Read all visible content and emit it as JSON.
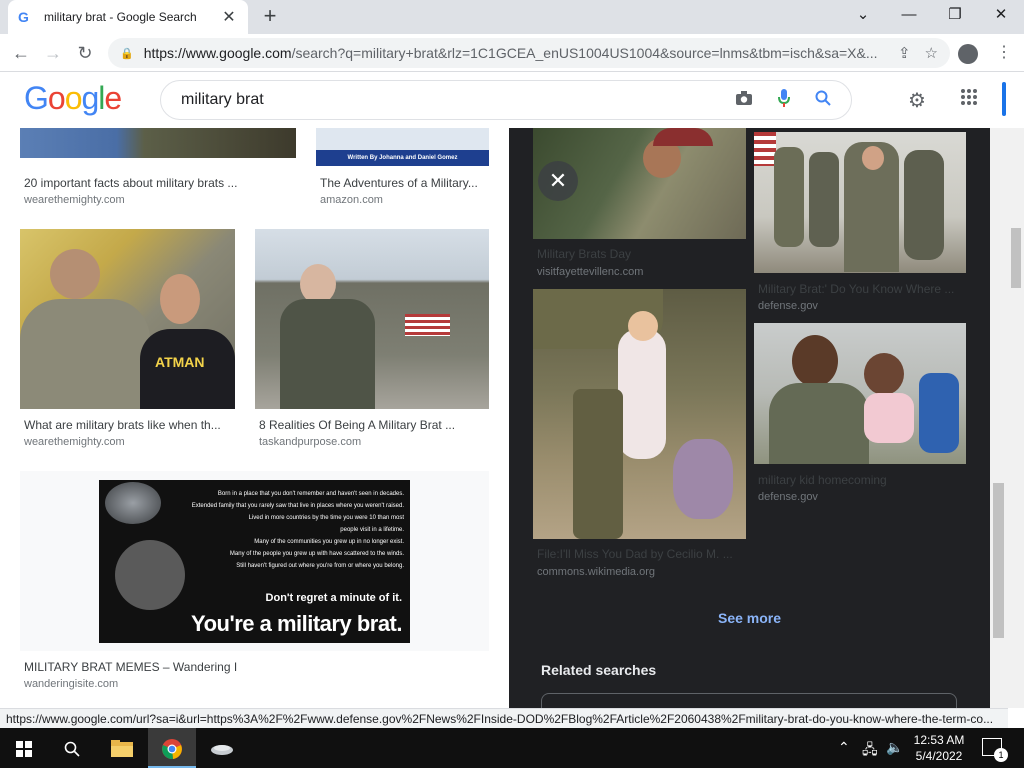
{
  "browser": {
    "tab_title": "military brat - Google Search",
    "tab_close": "✕",
    "new_tab": "+",
    "favicon": "G",
    "url_host": "https://www.google.com",
    "url_path": "/search?q=military+brat&rlz=1C1GCEA_enUS1004US1004&source=lnms&tbm=isch&sa=X&...",
    "window_controls": [
      "⌄",
      "—",
      "❐",
      "✕"
    ]
  },
  "google": {
    "logo_letters": [
      "G",
      "o",
      "o",
      "g",
      "l",
      "e"
    ],
    "logo_colors": [
      "#4285f4",
      "#ea4335",
      "#fbbc05",
      "#4285f4",
      "#34a853",
      "#ea4335"
    ],
    "query": "military brat"
  },
  "results": [
    {
      "caption": "20 important facts about military brats ...",
      "source": "wearethemighty.com"
    },
    {
      "caption": "The Adventures of a Military...",
      "source": "amazon.com",
      "book_banner": "Written By Johanna and Daniel Gomez"
    },
    {
      "caption": "What are military brats like when th...",
      "source": "wearethemighty.com",
      "shirt_text": "ATMAN"
    },
    {
      "caption": "8 Realities Of Being A Military Brat ...",
      "source": "taskandpurpose.com"
    },
    {
      "caption": "MILITARY BRAT MEMES – Wandering I",
      "source": "wanderingisite.com"
    }
  ],
  "meme": {
    "lines": [
      "Born in a place that you don't remember and haven't seen in decades.",
      "Extended family that you rarely saw that live in places where you weren't raised.",
      "Lived in more countries by the time you were 10 than most",
      "people visit in a lifetime.",
      "Many of the communities you grew up in no longer exist.",
      "Many of the people you grew up with have scattered to the winds.",
      "Still haven't figured out where you're from or where you belong."
    ],
    "tagline": "Don't regret a minute of it.",
    "headline": "You're a military brat."
  },
  "panel": {
    "items": [
      {
        "caption": "Military Brats Day",
        "source": "visitfayettevillenc.com"
      },
      {
        "caption": "Military Brat:' Do You Know Where ...",
        "source": "defense.gov"
      },
      {
        "caption": "File:I'll Miss You Dad by Cecilio M. ...",
        "source": "commons.wikimedia.org"
      },
      {
        "caption": "military kid homecoming",
        "source": "defense.gov"
      }
    ],
    "see_more": "See more",
    "related": "Related searches"
  },
  "status_url": "https://www.google.com/url?sa=i&url=https%3A%2F%2Fwww.defense.gov%2FNews%2FInside-DOD%2FBlog%2FArticle%2F2060438%2Fmilitary-brat-do-you-know-where-the-term-co...",
  "taskbar": {
    "time": "12:53 AM",
    "date": "5/4/2022",
    "notif_count": "1"
  }
}
